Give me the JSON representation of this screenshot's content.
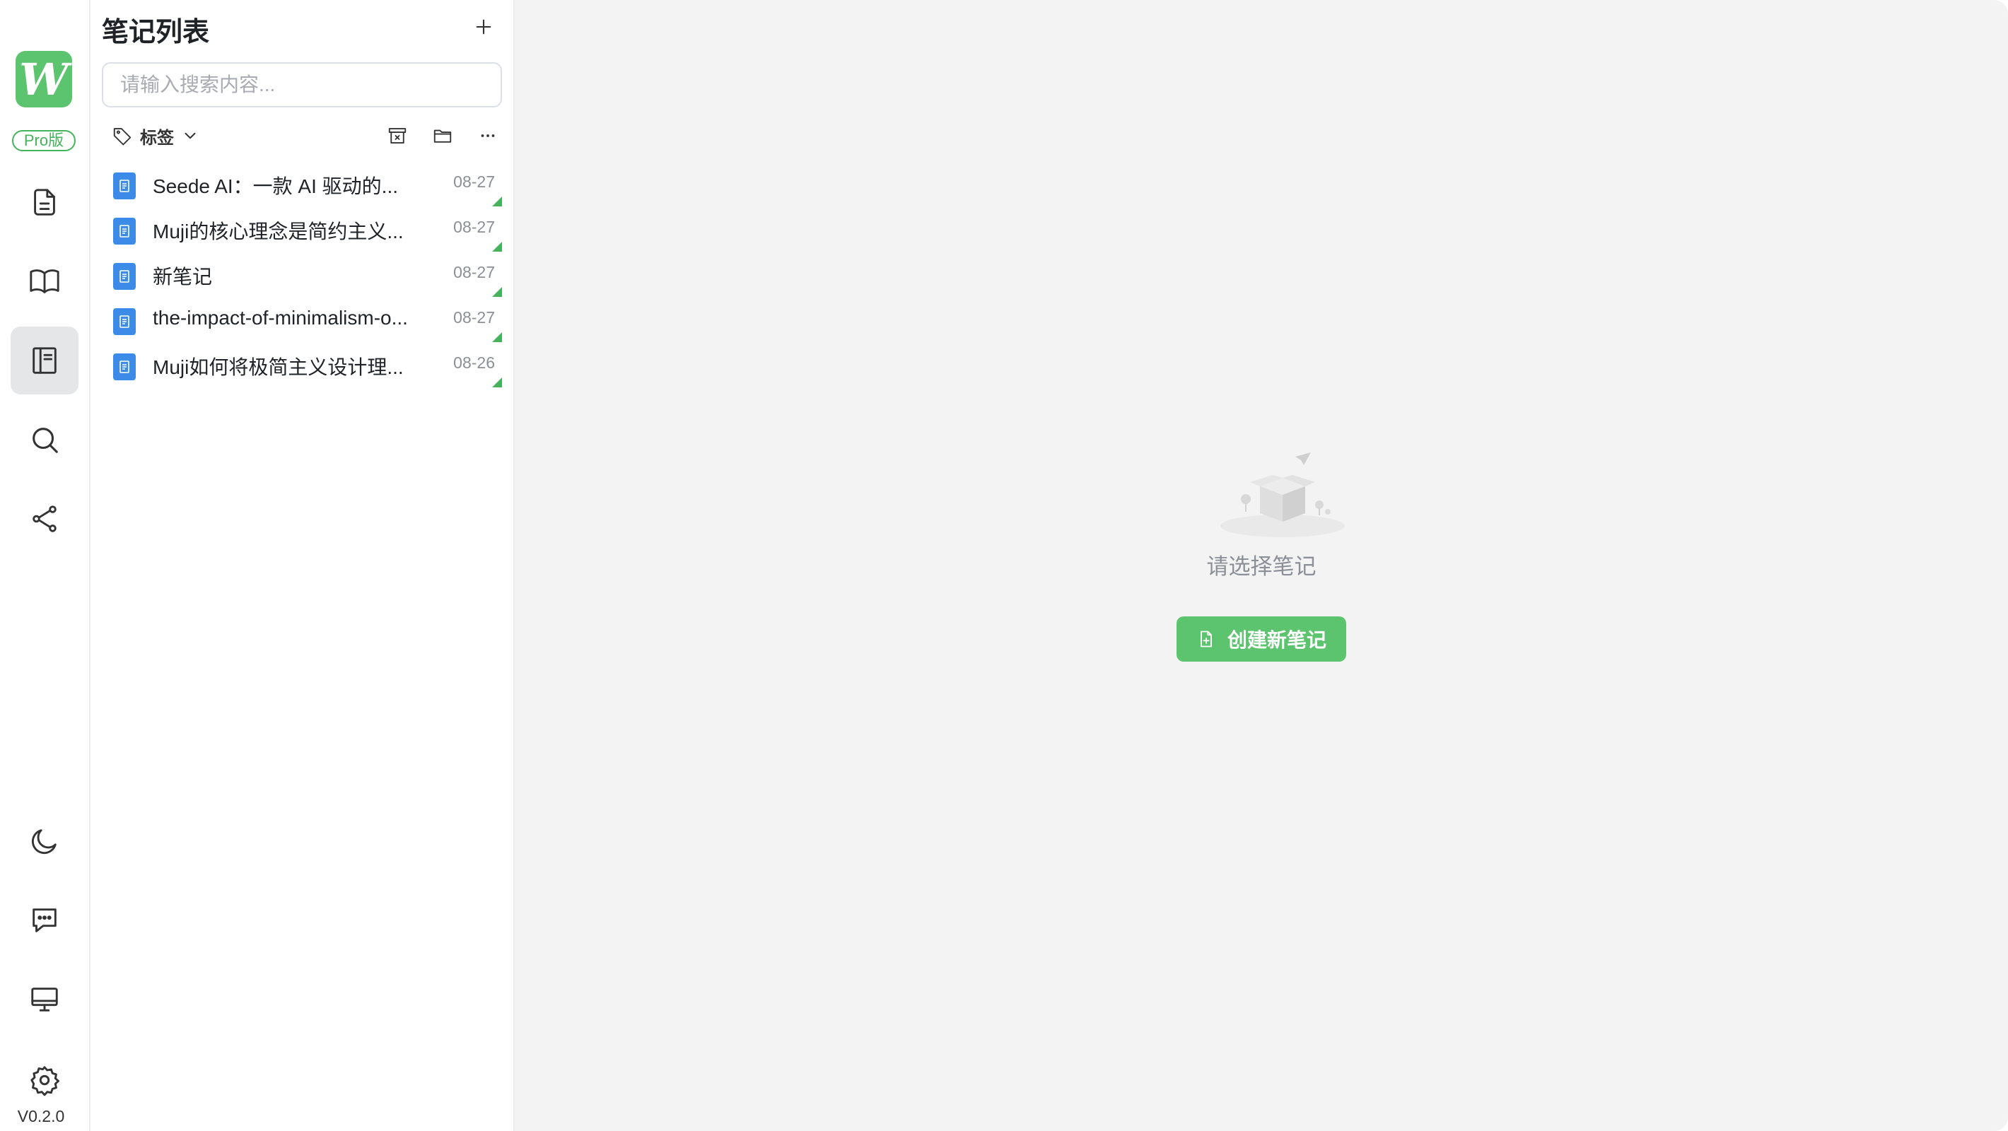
{
  "app": {
    "version": "V0.2.0",
    "pro_badge": "Pro版",
    "logo_letter": "W",
    "accent_color": "#5cc36f"
  },
  "rail": {
    "top_items": [
      {
        "icon": "document-icon",
        "active": false
      },
      {
        "icon": "book-icon",
        "active": false
      },
      {
        "icon": "notebook-icon",
        "active": true
      },
      {
        "icon": "search-icon",
        "active": false
      },
      {
        "icon": "share-icon",
        "active": false
      }
    ],
    "bottom_items": [
      {
        "icon": "moon-icon"
      },
      {
        "icon": "chat-icon"
      },
      {
        "icon": "monitor-icon"
      },
      {
        "icon": "gear-icon"
      }
    ]
  },
  "list": {
    "title": "笔记列表",
    "search_placeholder": "请输入搜索内容...",
    "tag_label": "标签",
    "notes": [
      {
        "title": "Seede AI：一款 AI 驱动的...",
        "date": "08-27"
      },
      {
        "title": "Muji的核心理念是简约主义...",
        "date": "08-27"
      },
      {
        "title": "新笔记",
        "date": "08-27"
      },
      {
        "title": "the-impact-of-minimalism-o...",
        "date": "08-27"
      },
      {
        "title": "Muji如何将极简主义设计理...",
        "date": "08-26"
      }
    ]
  },
  "main": {
    "empty_text": "请选择笔记",
    "create_button": "创建新笔记"
  }
}
